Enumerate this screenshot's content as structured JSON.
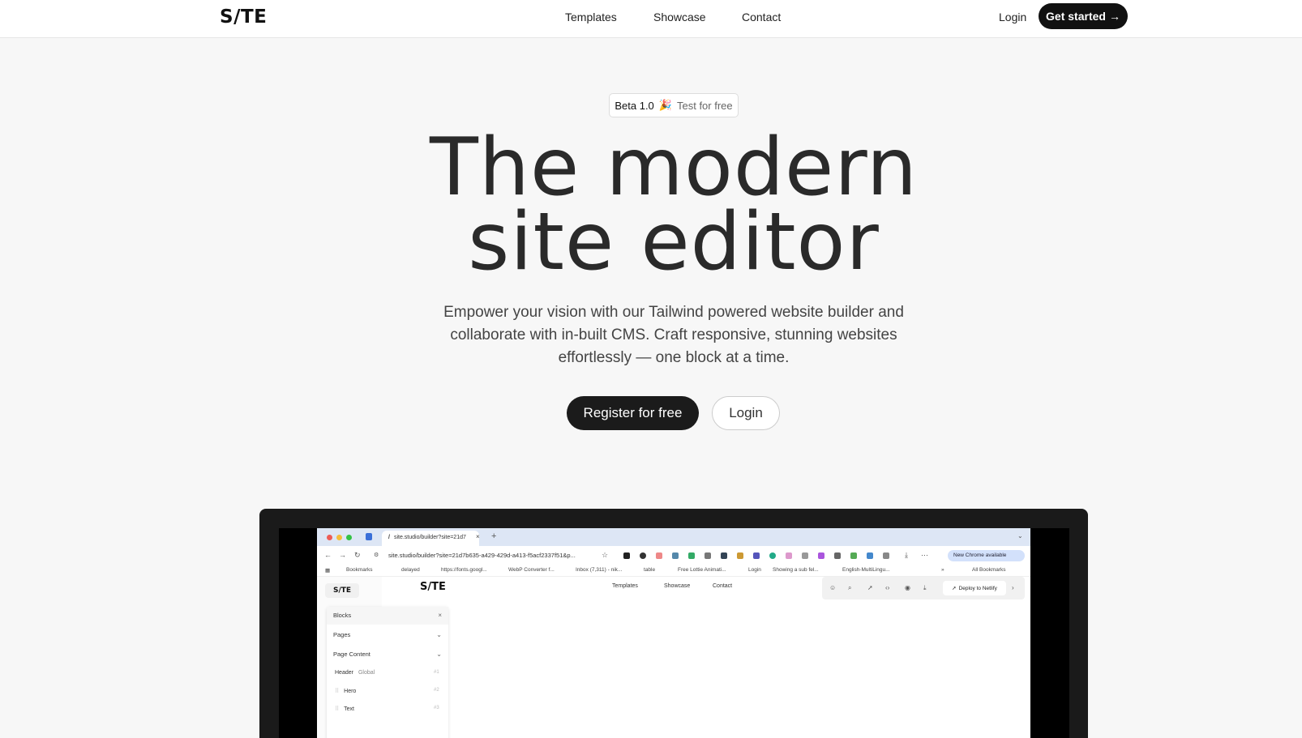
{
  "header": {
    "logo": "S/TE",
    "nav": [
      "Templates",
      "Showcase",
      "Contact"
    ],
    "login": "Login",
    "cta": "Get started",
    "cta_arrow": "→"
  },
  "hero": {
    "badge_version": "Beta 1.0",
    "badge_emoji": "🎉",
    "badge_text": "Test for free",
    "title_line1": "The modern",
    "title_line2": "site editor",
    "subtitle": "Empower your vision with our Tailwind powered website builder and collaborate with in-built CMS. Craft responsive, stunning websites effortlessly — one block at a time.",
    "register": "Register for free",
    "login": "Login"
  },
  "mockup": {
    "tab_title": "site.studio/builder?site=21d7",
    "tab_close": "×",
    "tab_plus": "+",
    "url": "site.studio/builder?site=21d7b635-a429-429d-a413-f5acf2337f51&p...",
    "chrome_pill": "New Chrome available",
    "bookmarks": [
      "Bookmarks",
      "delayed",
      "https://fonts.googl...",
      "WebP Converter f...",
      "Inbox (7,311) - nik...",
      "table",
      "Free Lottie Animati...",
      "Login",
      "Showing a sub fel...",
      "English-MultiLingu...",
      "All Bookmarks"
    ],
    "app_logo_left": "S/TE",
    "app_logo": "S/TE",
    "app_nav": [
      "Templates",
      "Showcase",
      "Contact"
    ],
    "deploy": "Deploy to Netlify",
    "panel": {
      "blocks": "Blocks",
      "pages": "Pages",
      "page_content": "Page Content",
      "items": [
        {
          "name": "Header",
          "tag": "Global",
          "num": "#1"
        },
        {
          "name": "Hero",
          "tag": "",
          "num": "#2"
        },
        {
          "name": "Text",
          "tag": "",
          "num": "#3"
        }
      ]
    }
  }
}
